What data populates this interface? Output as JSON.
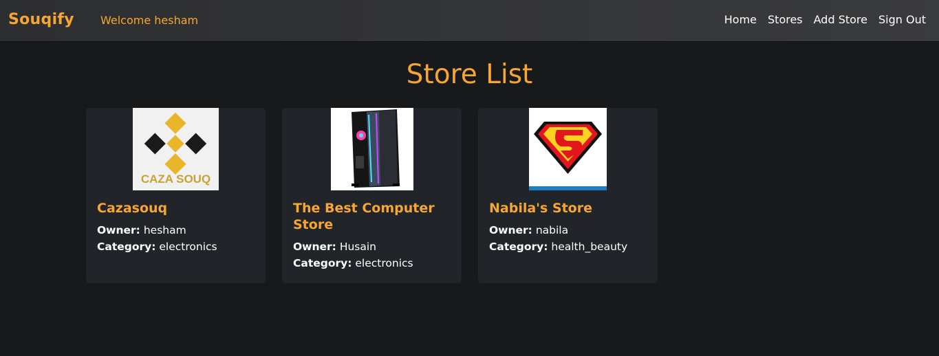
{
  "nav": {
    "brand": "Souqify",
    "welcome": "Welcome hesham",
    "links": [
      "Home",
      "Stores",
      "Add Store",
      "Sign Out"
    ]
  },
  "page": {
    "title": "Store List"
  },
  "stores": [
    {
      "name": "Cazasouq",
      "owner_label": "Owner:",
      "owner": "hesham",
      "category_label": "Category:",
      "category": "electronics",
      "logo_text": "CAZA SOUQ"
    },
    {
      "name": "The Best Computer Store",
      "owner_label": "Owner:",
      "owner": "Husain",
      "category_label": "Category:",
      "category": "electronics"
    },
    {
      "name": "Nabila's Store",
      "owner_label": "Owner:",
      "owner": "nabila",
      "category_label": "Category:",
      "category": "health_beauty"
    }
  ],
  "colors": {
    "accent": "#f7a634",
    "background": "#18191b",
    "card": "#212428",
    "navbar": "#333436"
  }
}
